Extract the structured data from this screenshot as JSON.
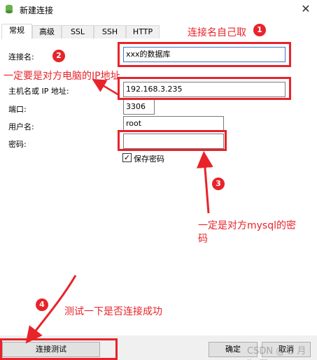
{
  "window": {
    "title": "新建连接",
    "close_glyph": "✕",
    "icon": "database-icon"
  },
  "tabs": [
    "常规",
    "高级",
    "SSL",
    "SSH",
    "HTTP"
  ],
  "active_tab": "常规",
  "form": {
    "connection_name_label": "连接名:",
    "connection_name_value": "xxx的数据库",
    "host_label": "主机名或 IP 地址:",
    "host_value": "192.168.3.235",
    "port_label": "端口:",
    "port_value": "3306",
    "username_label": "用户名:",
    "username_value": "root",
    "password_label": "密码:",
    "password_value": "",
    "save_password_label": "保存密码",
    "save_password_checked": true,
    "check_glyph": "✓"
  },
  "buttons": {
    "test": "连接测试",
    "ok": "确定",
    "cancel": "取消"
  },
  "annotations": {
    "note1": "连接名自己取",
    "note2": "一定要是对方电脑的IP地址",
    "note3_line1": "一定是对方mysql的密",
    "note3_line2": "码",
    "note4": "测试一下是否连接成功",
    "badge1": "1",
    "badge2": "2",
    "badge3": "3",
    "badge4": "4",
    "color": "#e8232a"
  },
  "watermark": "CSDN @七 月 犯 困"
}
